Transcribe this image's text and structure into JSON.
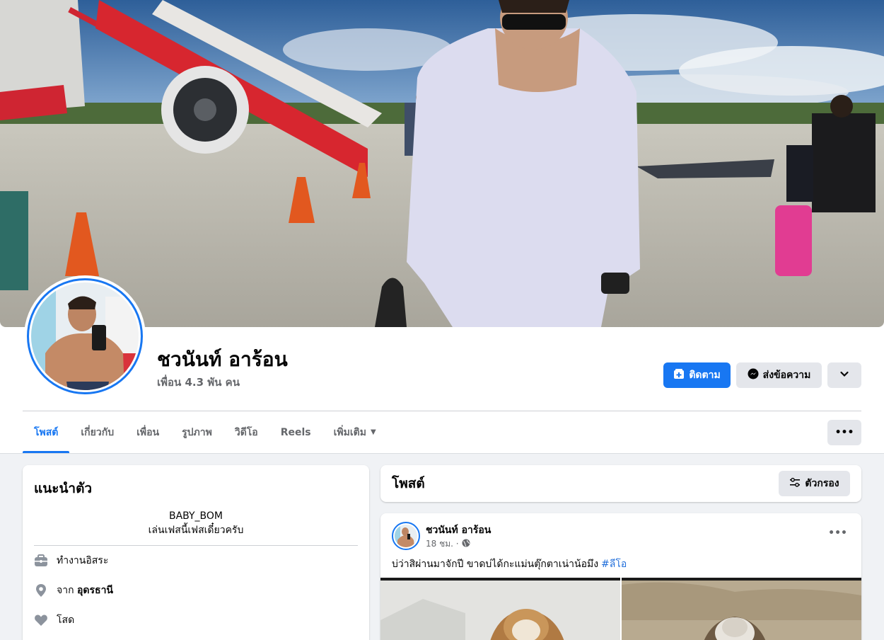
{
  "profile": {
    "name": "ชวนันท์ อาร้อน",
    "friends": "เพื่อน 4.3 พัน คน"
  },
  "actions": {
    "follow_label": "ติดตาม",
    "message_label": "ส่งข้อความ"
  },
  "tabs": [
    {
      "label": "โพสต์",
      "active": true
    },
    {
      "label": "เกี่ยวกับ"
    },
    {
      "label": "เพื่อน"
    },
    {
      "label": "รูปภาพ"
    },
    {
      "label": "วิดีโอ"
    },
    {
      "label": "Reels"
    },
    {
      "label": "เพิ่มเติม"
    }
  ],
  "intro": {
    "title": "แนะนำตัว",
    "bio_line1": "BABY_BOM",
    "bio_line2": "เล่นเฟสนี้เฟสเดี๋ยวครับ",
    "work": "ทำงานอิสระ",
    "from_prefix": "จาก",
    "from_place": "อุดรธานี",
    "relationship": "โสด"
  },
  "posts_header": {
    "title": "โพสต์",
    "filter_label": "ตัวกรอง"
  },
  "post": {
    "author": "ชวนันท์ อาร้อน",
    "time": "18 ชม. ·",
    "text": "บ่ว่าสิผ่านมาจักปี  ขาดบ่ได้กะแม่นตุ๊กตาเน่าน้อมึง",
    "hashtag": "#ลีโอ"
  },
  "colors": {
    "accent": "#1877f2",
    "background": "#f0f2f5",
    "secondary_button": "#e4e6eb"
  }
}
